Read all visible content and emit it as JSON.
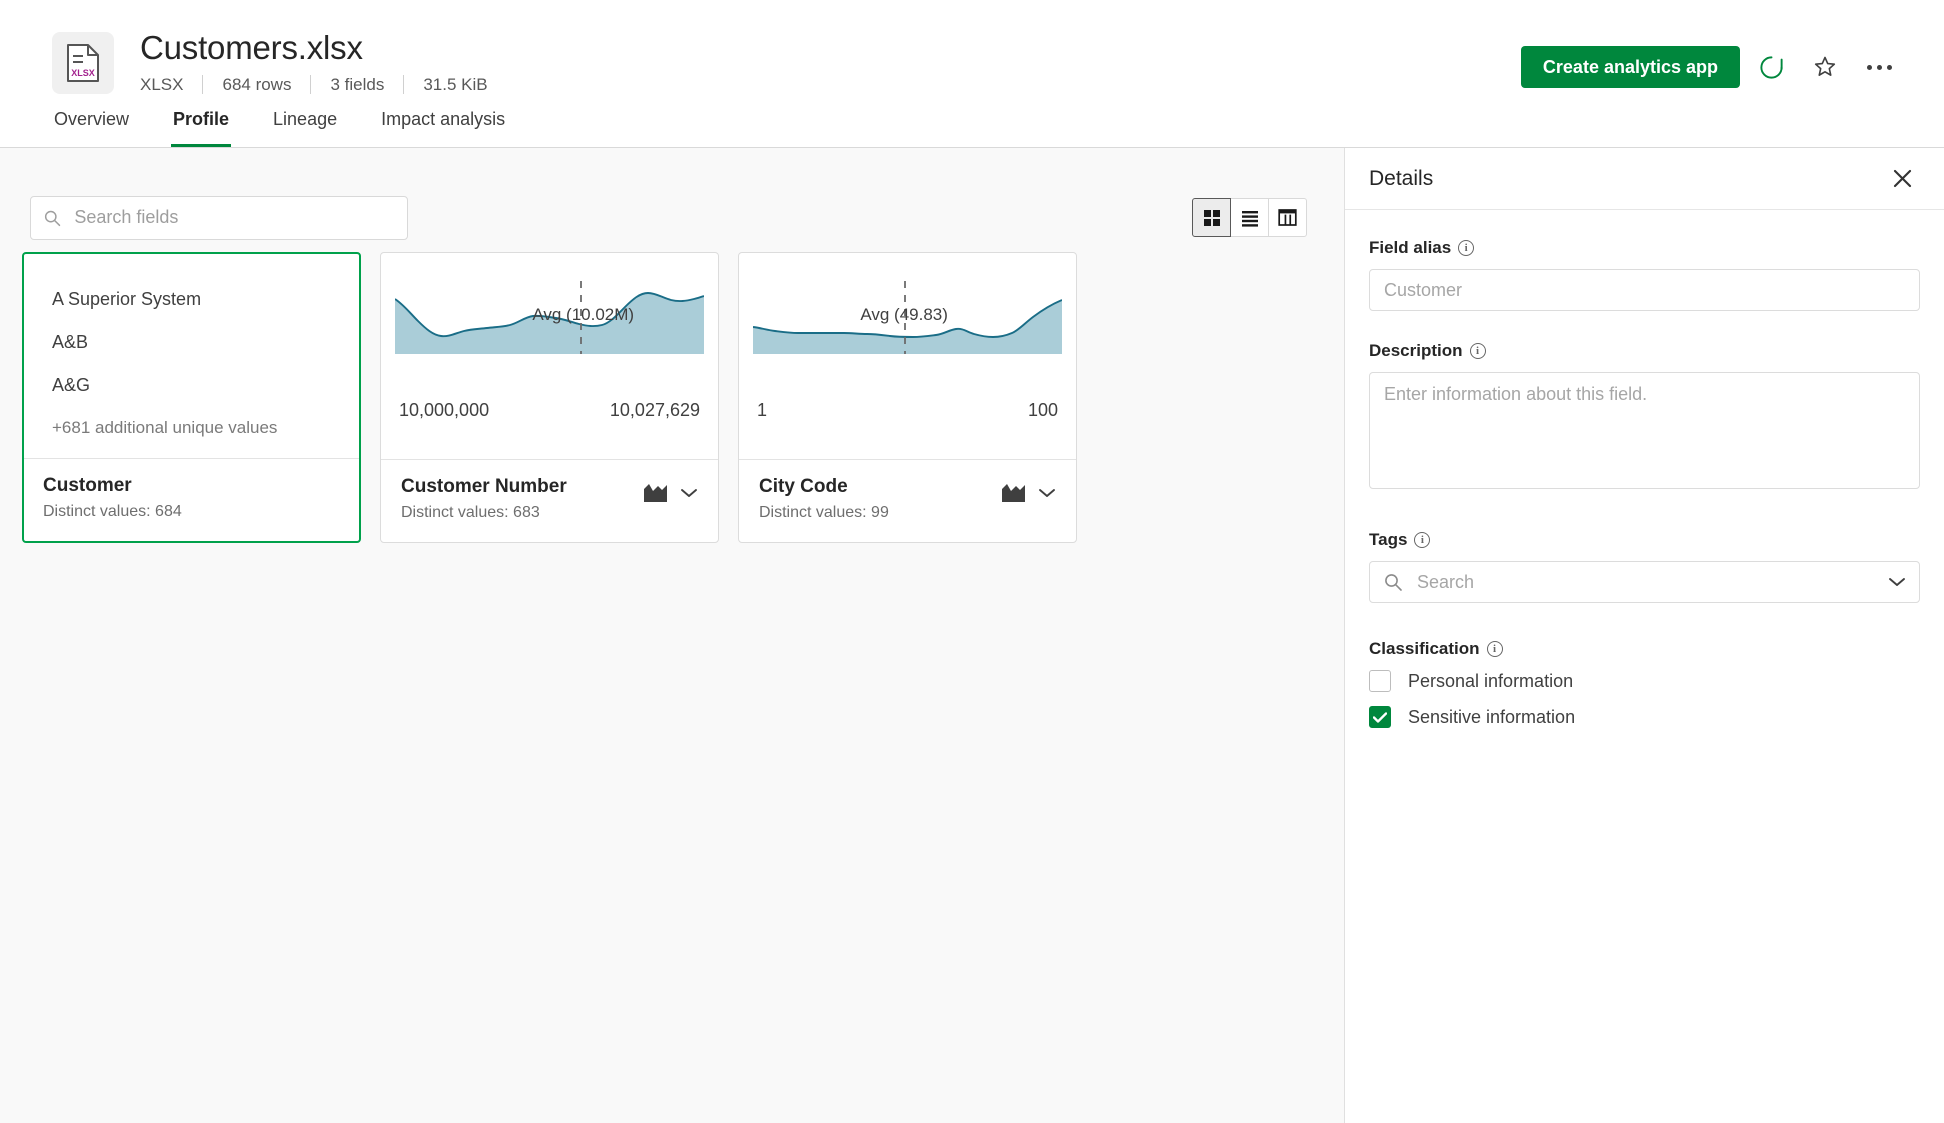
{
  "header": {
    "file_icon_label": "XLSX",
    "title": "Customers.xlsx",
    "meta": [
      "XLSX",
      "684 rows",
      "3 fields",
      "31.5 KiB"
    ],
    "create_app_label": "Create analytics app",
    "refresh_icon": "qlik-reload-icon",
    "favorite_icon": "star-icon",
    "more_icon": "more-options-icon"
  },
  "tabs": [
    {
      "label": "Overview",
      "active": false
    },
    {
      "label": "Profile",
      "active": true
    },
    {
      "label": "Lineage",
      "active": false
    },
    {
      "label": "Impact analysis",
      "active": false
    }
  ],
  "toolbar": {
    "search_placeholder": "Search fields",
    "search_value": "",
    "views": [
      {
        "name": "grid-view",
        "active": true
      },
      {
        "name": "list-view",
        "active": false
      },
      {
        "name": "table-view",
        "active": false
      }
    ]
  },
  "cards": [
    {
      "type": "values",
      "selected": true,
      "values": [
        "A Superior System",
        "A&B",
        "A&G"
      ],
      "more_values": "+681 additional unique values",
      "field_name": "Customer",
      "distinct": "Distinct values: 684"
    },
    {
      "type": "chart",
      "selected": false,
      "avg_label": "Avg (10.02M)",
      "min_label": "10,000,000",
      "max_label": "10,027,629",
      "field_name": "Customer Number",
      "distinct": "Distinct values: 683",
      "chart_icon": "area-chart-icon",
      "menu_icon": "chevron-down-icon"
    },
    {
      "type": "chart",
      "selected": false,
      "avg_label": "Avg (49.83)",
      "min_label": "1",
      "max_label": "100",
      "field_name": "City Code",
      "distinct": "Distinct values: 99",
      "chart_icon": "area-chart-icon",
      "menu_icon": "chevron-down-icon"
    }
  ],
  "details": {
    "title": "Details",
    "close_icon": "close-icon",
    "field_alias_label": "Field alias",
    "field_alias_value": "",
    "field_alias_placeholder": "Customer",
    "description_label": "Description",
    "description_value": "",
    "description_placeholder": "Enter information about this field.",
    "tags_label": "Tags",
    "tags_value": "",
    "tags_placeholder": "Search",
    "classification_label": "Classification",
    "classification": [
      {
        "label": "Personal information",
        "checked": false
      },
      {
        "label": "Sensitive information",
        "checked": true
      }
    ]
  },
  "colors": {
    "brand_green": "#00873d",
    "selected_green": "#00a14b",
    "chart_fill": "#aacdd8",
    "chart_stroke": "#1a6d87",
    "avg_dash": "#6b6b6b",
    "page_bg": "#f9f9f9"
  },
  "chart_data": [
    {
      "type": "area",
      "title": "Customer Number",
      "avg_label": "Avg (10.02M)",
      "avg": 10020000,
      "xmin_label": "10,000,000",
      "xmax_label": "10,027,629",
      "xlim": [
        10000000,
        10027629
      ],
      "ylabel": "",
      "xlabel": "",
      "grid": false,
      "legend": "none",
      "avg_marker_position_pct": 60,
      "x": [
        0,
        5,
        10,
        15,
        20,
        25,
        30,
        35,
        40,
        45,
        50,
        55,
        60,
        65,
        70,
        75,
        80,
        85,
        90,
        95,
        100
      ],
      "values": [
        62,
        52,
        36,
        28,
        27,
        32,
        36,
        37,
        38,
        44,
        48,
        46,
        42,
        36,
        36,
        44,
        58,
        72,
        68,
        62,
        63
      ]
    },
    {
      "type": "area",
      "title": "City Code",
      "avg_label": "Avg (49.83)",
      "avg": 49.83,
      "xmin_label": "1",
      "xmax_label": "100",
      "xlim": [
        1,
        100
      ],
      "ylabel": "",
      "xlabel": "",
      "grid": false,
      "legend": "none",
      "avg_marker_position_pct": 49,
      "x": [
        0,
        5,
        10,
        15,
        20,
        25,
        30,
        35,
        40,
        45,
        50,
        55,
        60,
        65,
        70,
        75,
        80,
        85,
        90,
        95,
        100
      ],
      "values": [
        26,
        24,
        22,
        21,
        21,
        21,
        21,
        21,
        21,
        20,
        19,
        19,
        20,
        23,
        27,
        24,
        20,
        19,
        22,
        34,
        45
      ]
    }
  ]
}
